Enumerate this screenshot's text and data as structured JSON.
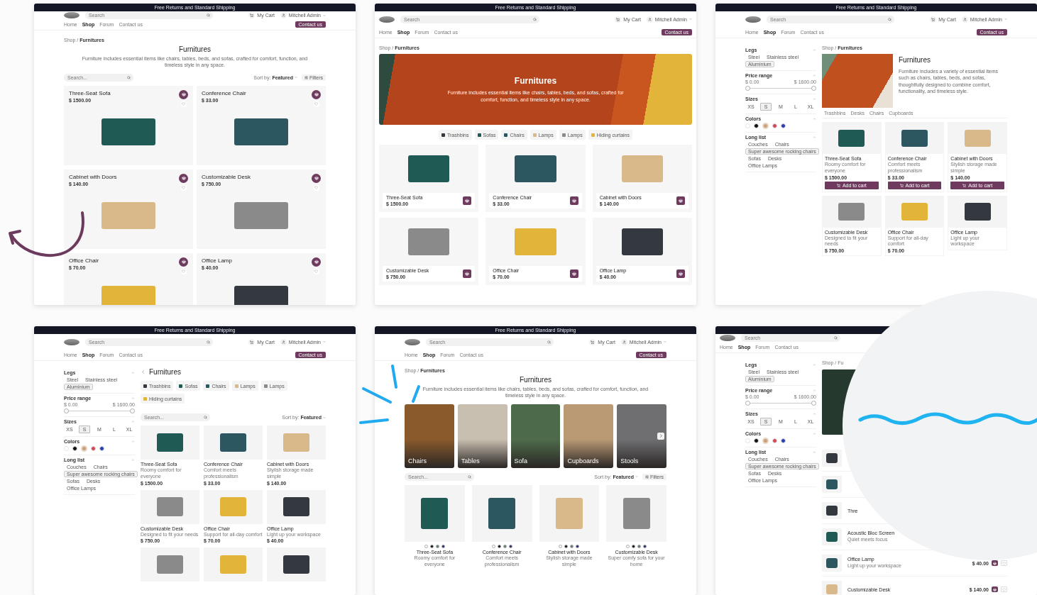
{
  "screens": [
    {
      "kind": "grid_two",
      "header": {
        "banner": "Free Returns and Standard Shipping",
        "search_placeholder": "Search",
        "cart": "My Cart",
        "user": "Mitchell Admin",
        "nav": [
          {
            "label": "Home",
            "selected": false
          },
          {
            "label": "Shop",
            "selected": true
          },
          {
            "label": "Forum",
            "selected": false
          },
          {
            "label": "Contact us",
            "selected": false
          }
        ],
        "contact_button": "Contact us"
      },
      "breadcrumb": "Shop / **Furnitures**",
      "title": "Furnitures",
      "description": "Furniture includes essential items like chairs, tables, beds, and sofas, crafted for comfort, function, and timeless style in any space.",
      "toolbar": {
        "search_placeholder": "Search...",
        "sort_label": "Sort by:",
        "sort_value": "Featured",
        "filters": "Filters"
      },
      "products": [
        {
          "name": "Three-Seat Sofa",
          "price": "$ 1500.00"
        },
        {
          "name": "Conference Chair",
          "price": "$ 33.00"
        },
        {
          "name": "Cabinet with Doors",
          "price": "$ 140.00"
        },
        {
          "name": "Customizable Desk",
          "price": "$ 750.00"
        },
        {
          "name": "Office Chair",
          "price": "$ 70.00"
        },
        {
          "name": "Office Lamp",
          "price": "$ 40.00"
        }
      ]
    },
    {
      "kind": "hero_grid3",
      "header": {
        "banner": "Free Returns and Standard Shipping",
        "search_placeholder": "Search",
        "cart": "My Cart",
        "user": "Mitchell Admin",
        "nav": [
          {
            "label": "Home",
            "selected": false
          },
          {
            "label": "Shop",
            "selected": true
          },
          {
            "label": "Forum",
            "selected": false
          },
          {
            "label": "Contact us",
            "selected": false
          }
        ],
        "contact_button": "Contact us"
      },
      "breadcrumb": "Shop / **Furnitures**",
      "title": "Furnitures",
      "description": "Furniture includes essential items like chairs, tables, beds, and sofas, crafted for comfort, function, and timeless style in any space.",
      "chips": [
        {
          "label": "Trashbins"
        },
        {
          "label": "Sofas"
        },
        {
          "label": "Chairs"
        },
        {
          "label": "Lamps"
        },
        {
          "label": "Lamps"
        },
        {
          "label": "Hiding curtains"
        }
      ],
      "products": [
        {
          "name": "Three-Seat Sofa",
          "price": "$ 1500.00"
        },
        {
          "name": "Conference Chair",
          "price": "$ 33.00"
        },
        {
          "name": "Cabinet with Doors",
          "price": "$ 140.00"
        },
        {
          "name": "Customizable Desk",
          "price": "$ 750.00"
        },
        {
          "name": "Office Chair",
          "price": "$ 70.00"
        },
        {
          "name": "Office Lamp",
          "price": "$ 40.00"
        }
      ]
    },
    {
      "kind": "sidebar_banner",
      "header": {
        "banner": "Free Returns and Standard Shipping",
        "search_placeholder": "Search",
        "cart": "My Cart",
        "user": "Mitchell Admin",
        "nav": [
          {
            "label": "Home",
            "selected": false
          },
          {
            "label": "Shop",
            "selected": true
          },
          {
            "label": "Forum",
            "selected": false
          },
          {
            "label": "Contact us",
            "selected": false
          }
        ],
        "contact_button": "Contact us"
      },
      "sidebar": {
        "sections": [
          {
            "kind": "chips",
            "title": "Legs",
            "expanded": true,
            "options": [
              {
                "label": "Steel",
                "selected": false
              },
              {
                "label": "Stainless steel",
                "selected": false
              },
              {
                "label": "Aluminium",
                "selected": true
              }
            ]
          },
          {
            "kind": "range",
            "title": "Price range",
            "expanded": true,
            "min": "$ 0.00",
            "max": "$ 1600.00",
            "thumbs": [
              {
                "level": 0
              },
              {
                "level": 1
              }
            ]
          },
          {
            "kind": "sizes",
            "title": "Sizes",
            "expanded": true,
            "options": [
              {
                "label": "XS",
                "selected": false
              },
              {
                "label": "S",
                "selected": true
              },
              {
                "label": "M",
                "selected": false
              },
              {
                "label": "L",
                "selected": false
              },
              {
                "label": "XL",
                "selected": false
              }
            ]
          },
          {
            "kind": "colors",
            "title": "Colors",
            "expanded": true,
            "options": [
              {
                "color": "#ffffff",
                "selected": false
              },
              {
                "color": "#111111",
                "selected": false
              },
              {
                "color": "#c9a27c",
                "selected": true
              },
              {
                "color": "#d64559",
                "selected": false
              },
              {
                "color": "#2a3db0",
                "selected": false
              }
            ]
          },
          {
            "kind": "chips",
            "title": "Long list",
            "expanded": true,
            "options": [
              {
                "label": "Couches",
                "selected": false
              },
              {
                "label": "Chairs",
                "selected": false
              },
              {
                "label": "Super awesome rocking chairs",
                "selected": true
              },
              {
                "label": "Sofas",
                "selected": false
              },
              {
                "label": "Desks",
                "selected": false
              },
              {
                "label": "Office Lamps",
                "selected": false
              }
            ]
          }
        ]
      },
      "breadcrumb": "Shop / **Furnitures**",
      "title": "Furnitures",
      "description": "Furniture includes a variety of essential items such as chairs, tables, beds, and sofas, thoughtfully designed to combine comfort, functionality, and timeless style.",
      "tabs": [
        {
          "label": "Trashbins"
        },
        {
          "label": "Desks"
        },
        {
          "label": "Chairs"
        },
        {
          "label": "Cupboards"
        }
      ],
      "products": [
        {
          "name": "Three-Seat Sofa",
          "subtitle": "Roomy comfort for everyone",
          "price": "$ 1500.00",
          "button": "Add to cart"
        },
        {
          "name": "Conference Chair",
          "subtitle": "Comfort meets professionalism",
          "price": "$ 33.00",
          "button": "Add to cart"
        },
        {
          "name": "Cabinet with Doors",
          "subtitle": "Stylish storage made simple",
          "price": "$ 140.00",
          "button": "Add to cart"
        },
        {
          "name": "Customizable Desk",
          "subtitle": "Designed to fit your needs",
          "price": "$ 750.00"
        },
        {
          "name": "Office Chair",
          "subtitle": "Support for all-day comfort",
          "price": "$ 70.00"
        },
        {
          "name": "Office Lamp",
          "subtitle": "Light up your workspace"
        }
      ]
    },
    {
      "kind": "sidebar_chips",
      "header": {
        "banner": "Free Returns and Standard Shipping",
        "search_placeholder": "Search",
        "cart": "My Cart",
        "user": "Mitchell Admin",
        "nav": [
          {
            "label": "Home",
            "selected": false
          },
          {
            "label": "Shop",
            "selected": true
          },
          {
            "label": "Forum",
            "selected": false
          },
          {
            "label": "Contact us",
            "selected": false
          }
        ],
        "contact_button": "Contact us"
      },
      "sidebar": {
        "sections": [
          {
            "kind": "chips",
            "title": "Legs",
            "expanded": true,
            "options": [
              {
                "label": "Steel",
                "selected": false
              },
              {
                "label": "Stainless steel",
                "selected": false
              },
              {
                "label": "Aluminium",
                "selected": true
              }
            ]
          },
          {
            "kind": "range",
            "title": "Price range",
            "expanded": true,
            "min": "$ 0.00",
            "max": "$ 1600.00",
            "thumbs": [
              {
                "level": 0
              },
              {
                "level": 1
              }
            ]
          },
          {
            "kind": "sizes",
            "title": "Sizes",
            "expanded": true,
            "options": [
              {
                "label": "XS",
                "selected": false
              },
              {
                "label": "S",
                "selected": true
              },
              {
                "label": "M",
                "selected": false
              },
              {
                "label": "L",
                "selected": false
              },
              {
                "label": "XL",
                "selected": false
              }
            ]
          },
          {
            "kind": "colors",
            "title": "Colors",
            "expanded": true,
            "options": [
              {
                "color": "#ffffff",
                "selected": false
              },
              {
                "color": "#111111",
                "selected": false
              },
              {
                "color": "#c9a27c",
                "selected": true
              },
              {
                "color": "#d64559",
                "selected": false
              },
              {
                "color": "#2a3db0",
                "selected": false
              }
            ]
          },
          {
            "kind": "chips",
            "title": "Long list",
            "expanded": true,
            "options": [
              {
                "label": "Couches",
                "selected": false
              },
              {
                "label": "Chairs",
                "selected": false
              },
              {
                "label": "Super awesome rocking chairs",
                "selected": true
              },
              {
                "label": "Sofas",
                "selected": false
              },
              {
                "label": "Desks",
                "selected": false
              },
              {
                "label": "Office Lamps",
                "selected": false
              }
            ]
          }
        ]
      },
      "title": "Furnitures",
      "chips": [
        {
          "label": "Trashbins"
        },
        {
          "label": "Sofas"
        },
        {
          "label": "Chairs"
        },
        {
          "label": "Lamps"
        },
        {
          "label": "Lamps"
        },
        {
          "label": "Hiding curtains"
        }
      ],
      "toolbar": {
        "search_placeholder": "Search...",
        "sort_label": "Sort by:",
        "sort_value": "Featured"
      },
      "products": [
        {
          "name": "Three-Seat Sofa",
          "subtitle": "Roomy comfort for everyone",
          "price": "$ 1500.00"
        },
        {
          "name": "Conference Chair",
          "subtitle": "Comfort meets professionalism",
          "price": "$ 33.00"
        },
        {
          "name": "Cabinet with Doors",
          "subtitle": "Stylish storage made simple",
          "price": "$ 140.00"
        },
        {
          "name": "Customizable Desk",
          "subtitle": "Designed to fit your needs",
          "price": "$ 750.00"
        },
        {
          "name": "Office Chair",
          "subtitle": "Support for all-day comfort",
          "price": "$ 70.00"
        },
        {
          "name": "Office Lamp",
          "subtitle": "Light up your workspace",
          "price": "$ 40.00"
        }
      ]
    },
    {
      "kind": "categories",
      "header": {
        "banner": "Free Returns and Standard Shipping",
        "search_placeholder": "Search",
        "cart": "My Cart",
        "user": "Mitchell Admin",
        "nav": [
          {
            "label": "Home",
            "selected": false
          },
          {
            "label": "Shop",
            "selected": true
          },
          {
            "label": "Forum",
            "selected": false
          },
          {
            "label": "Contact us",
            "selected": false
          }
        ],
        "contact_button": "Contact us"
      },
      "breadcrumb": "Shop / **Furnitures**",
      "title": "Furnitures",
      "description": "Furniture includes essential items like chairs, tables, beds, and sofas, crafted for comfort, function, and timeless style in any space.",
      "categories": [
        {
          "label": "Chairs"
        },
        {
          "label": "Tables"
        },
        {
          "label": "Sofa"
        },
        {
          "label": "Cupboards"
        },
        {
          "label": "Stools"
        }
      ],
      "toolbar": {
        "search_placeholder": "Search...",
        "sort_label": "Sort by:",
        "sort_value": "Featured",
        "filters": "Filters"
      },
      "products": [
        {
          "name": "Three-Seat Sofa",
          "subtitle": "Roomy comfort for everyone",
          "colors": [
            {
              "color": "#ffffff"
            },
            {
              "color": "#111111"
            },
            {
              "color": "#5e7d78"
            },
            {
              "color": "#272d6e"
            }
          ]
        },
        {
          "name": "Conference Chair",
          "subtitle": "Comfort meets professionalism",
          "colors": [
            {
              "color": "#ffffff"
            },
            {
              "color": "#111111"
            },
            {
              "color": "#5e7d78"
            },
            {
              "color": "#272d6e"
            }
          ]
        },
        {
          "name": "Cabinet with Doors",
          "subtitle": "Stylish storage made simple",
          "colors": [
            {
              "color": "#ffffff"
            },
            {
              "color": "#111111"
            },
            {
              "color": "#5e7d78"
            },
            {
              "color": "#272d6e"
            }
          ]
        },
        {
          "name": "Customizable Desk",
          "subtitle": "Super comfy sofa for your home",
          "colors": [
            {
              "color": "#ffffff"
            },
            {
              "color": "#111111"
            },
            {
              "color": "#5e7d78"
            },
            {
              "color": "#272d6e"
            }
          ]
        }
      ]
    },
    {
      "kind": "sidebar_list",
      "header": {
        "search_placeholder": "Search",
        "nav": [
          {
            "label": "Home",
            "selected": false
          },
          {
            "label": "Shop",
            "selected": true
          },
          {
            "label": "Forum",
            "selected": false
          },
          {
            "label": "Contact us",
            "selected": false
          }
        ]
      },
      "sidebar": {
        "sections": [
          {
            "kind": "chips",
            "title": "Legs",
            "expanded": true,
            "options": [
              {
                "label": "Steel",
                "selected": false
              },
              {
                "label": "Stainless steel",
                "selected": false
              },
              {
                "label": "Aluminium",
                "selected": true
              }
            ]
          },
          {
            "kind": "range",
            "title": "Price range",
            "expanded": true,
            "min": "$ 0.00",
            "max": "$ 1600.00",
            "thumbs": [
              {
                "level": 0
              },
              {
                "level": 1
              }
            ]
          },
          {
            "kind": "sizes",
            "title": "Sizes",
            "expanded": true,
            "options": [
              {
                "label": "XS",
                "selected": false
              },
              {
                "label": "S",
                "selected": true
              },
              {
                "label": "M",
                "selected": false
              },
              {
                "label": "L",
                "selected": false
              },
              {
                "label": "XL",
                "selected": false
              }
            ]
          },
          {
            "kind": "colors",
            "title": "Colors",
            "expanded": true,
            "options": [
              {
                "color": "#ffffff",
                "selected": false
              },
              {
                "color": "#111111",
                "selected": false
              },
              {
                "color": "#c9a27c",
                "selected": true
              },
              {
                "color": "#d64559",
                "selected": false
              },
              {
                "color": "#2a3db0",
                "selected": false
              }
            ]
          },
          {
            "kind": "chips",
            "title": "Long list",
            "expanded": true,
            "options": [
              {
                "label": "Couches",
                "selected": false
              },
              {
                "label": "Chairs",
                "selected": false
              },
              {
                "label": "Super awesome rocking chairs",
                "selected": true
              },
              {
                "label": "Sofas",
                "selected": false
              },
              {
                "label": "Desks",
                "selected": false
              },
              {
                "label": "Office Lamps",
                "selected": false
              }
            ]
          }
        ]
      },
      "breadcrumb": "Shop / Fu",
      "rows": [
        {
          "kind": "thumb"
        },
        {
          "kind": "thumb"
        },
        {
          "kind": "item",
          "name": "Thre"
        },
        {
          "kind": "item",
          "name": "Acoustic Bloc Screen",
          "subtitle": "Quiet meets focus"
        },
        {
          "kind": "item",
          "name": "Office Lamp",
          "subtitle": "Light up your workspace",
          "price": "$ 40.00"
        },
        {
          "kind": "item",
          "name": "Customizable Desk",
          "price": "$ 140.00"
        }
      ]
    }
  ]
}
